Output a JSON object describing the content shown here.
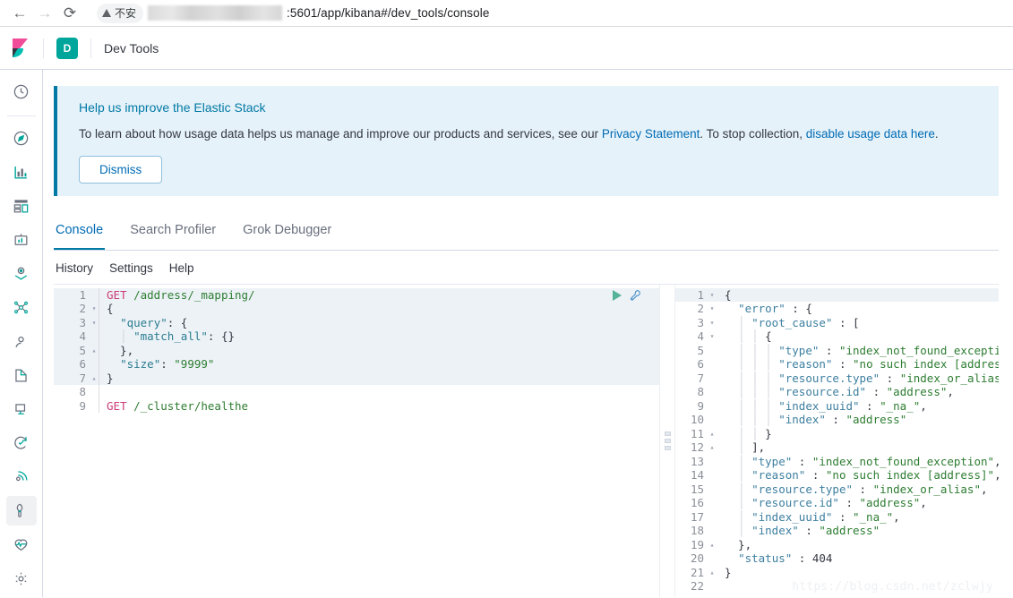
{
  "browser": {
    "back_icon": "arrow-left-icon",
    "forward_icon": "arrow-right-icon",
    "reload_icon": "reload-icon",
    "security_icon": "warning-triangle-icon",
    "security_label": "不安",
    "url_visible_tail": ":5601/app/kibana#/dev_tools/console"
  },
  "header": {
    "logo_icon": "kibana-logo-icon",
    "space_badge": "D",
    "app_title": "Dev Tools"
  },
  "sidebar": {
    "items": [
      {
        "icon": "clock-icon",
        "name": "recently-viewed"
      },
      {
        "icon": "compass-icon",
        "name": "discover"
      },
      {
        "icon": "bar-chart-icon",
        "name": "visualize"
      },
      {
        "icon": "dashboard-icon",
        "name": "dashboard"
      },
      {
        "icon": "canvas-icon",
        "name": "canvas"
      },
      {
        "icon": "map-pin-icon",
        "name": "maps"
      },
      {
        "icon": "graph-icon",
        "name": "graph"
      },
      {
        "icon": "user-icon",
        "name": "machine-learning"
      },
      {
        "icon": "logs-icon",
        "name": "logs"
      },
      {
        "icon": "metrics-icon",
        "name": "metrics"
      },
      {
        "icon": "uptime-icon",
        "name": "uptime"
      },
      {
        "icon": "apm-icon",
        "name": "apm"
      },
      {
        "icon": "wrench-icon",
        "name": "dev-tools",
        "active": true
      },
      {
        "icon": "heartbeat-icon",
        "name": "monitoring"
      },
      {
        "icon": "gear-icon",
        "name": "management"
      }
    ]
  },
  "banner": {
    "title": "Help us improve the Elastic Stack",
    "body_pre": "To learn about how usage data helps us manage and improve our products and services, see our ",
    "link_privacy": "Privacy Statement",
    "body_mid": ". To stop collection, ",
    "link_disable": "disable usage data here",
    "body_post": ".",
    "dismiss_label": "Dismiss"
  },
  "tabs": [
    {
      "label": "Console",
      "active": true
    },
    {
      "label": "Search Profiler",
      "active": false
    },
    {
      "label": "Grok Debugger",
      "active": false
    }
  ],
  "submenu": [
    {
      "label": "History"
    },
    {
      "label": "Settings"
    },
    {
      "label": "Help"
    }
  ],
  "request_editor": {
    "run_icon": "play-icon",
    "wrench_icon": "wrench-icon",
    "lines": [
      {
        "n": "1",
        "fold": "",
        "hl": true,
        "tokens": [
          {
            "t": "method",
            "v": "GET"
          },
          {
            "t": "punc",
            "v": " "
          },
          {
            "t": "url",
            "v": "/address/_mapping/"
          }
        ]
      },
      {
        "n": "2",
        "fold": "▾",
        "hl": true,
        "tokens": [
          {
            "t": "punc",
            "v": "{"
          }
        ]
      },
      {
        "n": "3",
        "fold": "▾",
        "hl": true,
        "tokens": [
          {
            "t": "punc",
            "v": "  "
          },
          {
            "t": "key",
            "v": "\"query\""
          },
          {
            "t": "punc",
            "v": ": {"
          }
        ]
      },
      {
        "n": "4",
        "fold": "",
        "hl": true,
        "tokens": [
          {
            "t": "guide",
            "v": "  │ "
          },
          {
            "t": "key",
            "v": "\"match_all\""
          },
          {
            "t": "punc",
            "v": ": {}"
          }
        ]
      },
      {
        "n": "5",
        "fold": "▴",
        "hl": true,
        "tokens": [
          {
            "t": "punc",
            "v": "  },"
          }
        ]
      },
      {
        "n": "6",
        "fold": "",
        "hl": true,
        "tokens": [
          {
            "t": "punc",
            "v": "  "
          },
          {
            "t": "key",
            "v": "\"size\""
          },
          {
            "t": "punc",
            "v": ": "
          },
          {
            "t": "str",
            "v": "\"9999\""
          }
        ]
      },
      {
        "n": "7",
        "fold": "▴",
        "hl": true,
        "tokens": [
          {
            "t": "punc",
            "v": "}"
          }
        ]
      },
      {
        "n": "8",
        "fold": "",
        "hl": false,
        "tokens": [
          {
            "t": "punc",
            "v": ""
          }
        ]
      },
      {
        "n": "9",
        "fold": "",
        "hl": false,
        "tokens": [
          {
            "t": "method",
            "v": "GET"
          },
          {
            "t": "punc",
            "v": " "
          },
          {
            "t": "url",
            "v": "/_cluster/healthe"
          }
        ]
      }
    ]
  },
  "response_editor": {
    "lines": [
      {
        "n": "1",
        "fold": "▾",
        "hl": true,
        "tokens": [
          {
            "t": "punc",
            "v": "{"
          }
        ]
      },
      {
        "n": "2",
        "fold": "▾",
        "hl": false,
        "tokens": [
          {
            "t": "punc",
            "v": "  "
          },
          {
            "t": "rkey",
            "v": "\"error\""
          },
          {
            "t": "punc",
            "v": " : {"
          }
        ]
      },
      {
        "n": "3",
        "fold": "▾",
        "hl": false,
        "tokens": [
          {
            "t": "guide",
            "v": "  │ "
          },
          {
            "t": "rkey",
            "v": "\"root_cause\""
          },
          {
            "t": "punc",
            "v": " : ["
          }
        ]
      },
      {
        "n": "4",
        "fold": "▾",
        "hl": false,
        "tokens": [
          {
            "t": "guide",
            "v": "  │ │ "
          },
          {
            "t": "punc",
            "v": "{"
          }
        ]
      },
      {
        "n": "5",
        "fold": "",
        "hl": false,
        "tokens": [
          {
            "t": "guide",
            "v": "  │ │ │ "
          },
          {
            "t": "rkey",
            "v": "\"type\""
          },
          {
            "t": "punc",
            "v": " : "
          },
          {
            "t": "str",
            "v": "\"index_not_found_exception\""
          },
          {
            "t": "punc",
            "v": ","
          }
        ]
      },
      {
        "n": "6",
        "fold": "",
        "hl": false,
        "tokens": [
          {
            "t": "guide",
            "v": "  │ │ │ "
          },
          {
            "t": "rkey",
            "v": "\"reason\""
          },
          {
            "t": "punc",
            "v": " : "
          },
          {
            "t": "str",
            "v": "\"no such index [address]\""
          },
          {
            "t": "punc",
            "v": ","
          }
        ]
      },
      {
        "n": "7",
        "fold": "",
        "hl": false,
        "tokens": [
          {
            "t": "guide",
            "v": "  │ │ │ "
          },
          {
            "t": "rkey",
            "v": "\"resource.type\""
          },
          {
            "t": "punc",
            "v": " : "
          },
          {
            "t": "str",
            "v": "\"index_or_alias\""
          },
          {
            "t": "punc",
            "v": ","
          }
        ]
      },
      {
        "n": "8",
        "fold": "",
        "hl": false,
        "tokens": [
          {
            "t": "guide",
            "v": "  │ │ │ "
          },
          {
            "t": "rkey",
            "v": "\"resource.id\""
          },
          {
            "t": "punc",
            "v": " : "
          },
          {
            "t": "str",
            "v": "\"address\""
          },
          {
            "t": "punc",
            "v": ","
          }
        ]
      },
      {
        "n": "9",
        "fold": "",
        "hl": false,
        "tokens": [
          {
            "t": "guide",
            "v": "  │ │ │ "
          },
          {
            "t": "rkey",
            "v": "\"index_uuid\""
          },
          {
            "t": "punc",
            "v": " : "
          },
          {
            "t": "str",
            "v": "\"_na_\""
          },
          {
            "t": "punc",
            "v": ","
          }
        ]
      },
      {
        "n": "10",
        "fold": "",
        "hl": false,
        "tokens": [
          {
            "t": "guide",
            "v": "  │ │ │ "
          },
          {
            "t": "rkey",
            "v": "\"index\""
          },
          {
            "t": "punc",
            "v": " : "
          },
          {
            "t": "str",
            "v": "\"address\""
          }
        ]
      },
      {
        "n": "11",
        "fold": "▴",
        "hl": false,
        "tokens": [
          {
            "t": "guide",
            "v": "  │ │ "
          },
          {
            "t": "punc",
            "v": "}"
          }
        ]
      },
      {
        "n": "12",
        "fold": "▴",
        "hl": false,
        "tokens": [
          {
            "t": "guide",
            "v": "  │ "
          },
          {
            "t": "punc",
            "v": "],"
          }
        ]
      },
      {
        "n": "13",
        "fold": "",
        "hl": false,
        "tokens": [
          {
            "t": "guide",
            "v": "  │ "
          },
          {
            "t": "rkey",
            "v": "\"type\""
          },
          {
            "t": "punc",
            "v": " : "
          },
          {
            "t": "str",
            "v": "\"index_not_found_exception\""
          },
          {
            "t": "punc",
            "v": ","
          }
        ]
      },
      {
        "n": "14",
        "fold": "",
        "hl": false,
        "tokens": [
          {
            "t": "guide",
            "v": "  │ "
          },
          {
            "t": "rkey",
            "v": "\"reason\""
          },
          {
            "t": "punc",
            "v": " : "
          },
          {
            "t": "str",
            "v": "\"no such index [address]\""
          },
          {
            "t": "punc",
            "v": ","
          }
        ]
      },
      {
        "n": "15",
        "fold": "",
        "hl": false,
        "tokens": [
          {
            "t": "guide",
            "v": "  │ "
          },
          {
            "t": "rkey",
            "v": "\"resource.type\""
          },
          {
            "t": "punc",
            "v": " : "
          },
          {
            "t": "str",
            "v": "\"index_or_alias\""
          },
          {
            "t": "punc",
            "v": ","
          }
        ]
      },
      {
        "n": "16",
        "fold": "",
        "hl": false,
        "tokens": [
          {
            "t": "guide",
            "v": "  │ "
          },
          {
            "t": "rkey",
            "v": "\"resource.id\""
          },
          {
            "t": "punc",
            "v": " : "
          },
          {
            "t": "str",
            "v": "\"address\""
          },
          {
            "t": "punc",
            "v": ","
          }
        ]
      },
      {
        "n": "17",
        "fold": "",
        "hl": false,
        "tokens": [
          {
            "t": "guide",
            "v": "  │ "
          },
          {
            "t": "rkey",
            "v": "\"index_uuid\""
          },
          {
            "t": "punc",
            "v": " : "
          },
          {
            "t": "str",
            "v": "\"_na_\""
          },
          {
            "t": "punc",
            "v": ","
          }
        ]
      },
      {
        "n": "18",
        "fold": "",
        "hl": false,
        "tokens": [
          {
            "t": "guide",
            "v": "  │ "
          },
          {
            "t": "rkey",
            "v": "\"index\""
          },
          {
            "t": "punc",
            "v": " : "
          },
          {
            "t": "str",
            "v": "\"address\""
          }
        ]
      },
      {
        "n": "19",
        "fold": "▴",
        "hl": false,
        "tokens": [
          {
            "t": "punc",
            "v": "  },"
          }
        ]
      },
      {
        "n": "20",
        "fold": "",
        "hl": false,
        "tokens": [
          {
            "t": "punc",
            "v": "  "
          },
          {
            "t": "rkey",
            "v": "\"status\""
          },
          {
            "t": "punc",
            "v": " : "
          },
          {
            "t": "num",
            "v": "404"
          }
        ]
      },
      {
        "n": "21",
        "fold": "▴",
        "hl": false,
        "tokens": [
          {
            "t": "punc",
            "v": "}"
          }
        ]
      },
      {
        "n": "22",
        "fold": "",
        "hl": false,
        "tokens": [
          {
            "t": "punc",
            "v": ""
          }
        ]
      }
    ]
  },
  "watermark": "https://blog.csdn.net/zclwjy",
  "colors": {
    "accent_blue": "#006bb4",
    "banner_bg": "#e6f2f9",
    "banner_border": "#0079a5",
    "space_badge": "#00a69b",
    "method": "#cc3d78",
    "string": "#2e7d32",
    "key": "#2b7d8f"
  }
}
